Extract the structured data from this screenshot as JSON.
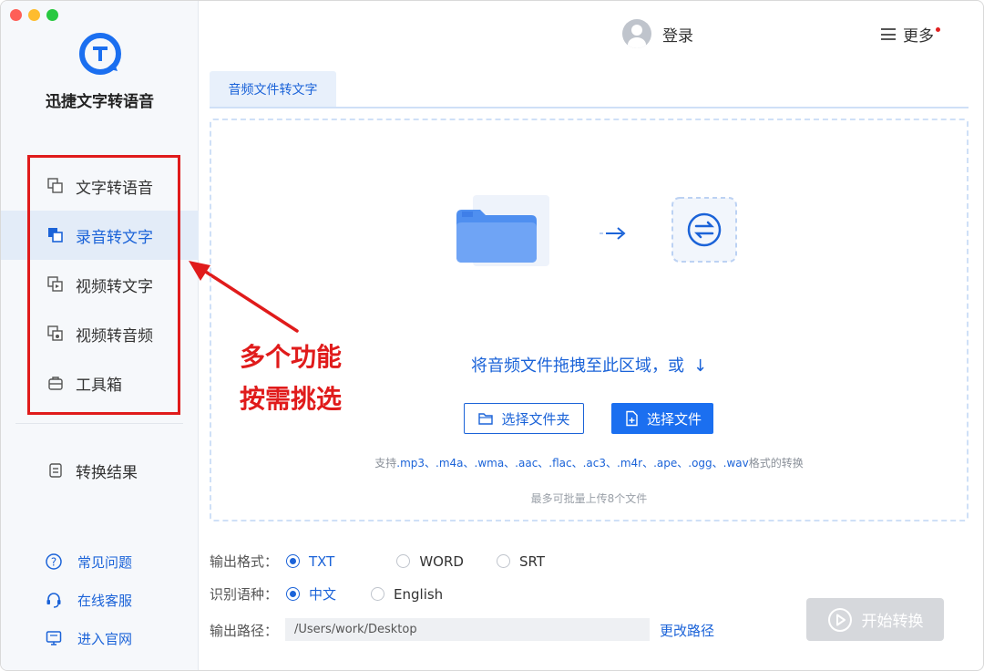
{
  "app": {
    "title": "迅捷文字转语音"
  },
  "colors": {
    "accent": "#1b63d8",
    "annotation": "#e01b1b",
    "sidebar_bg": "#f6f8fb"
  },
  "sidebar": {
    "items": [
      {
        "label": "文字转语音",
        "icon": "text-to-speech-icon",
        "active": false
      },
      {
        "label": "录音转文字",
        "icon": "recording-to-text-icon",
        "active": true
      },
      {
        "label": "视频转文字",
        "icon": "video-to-text-icon",
        "active": false
      },
      {
        "label": "视频转音频",
        "icon": "video-to-audio-icon",
        "active": false
      },
      {
        "label": "工具箱",
        "icon": "toolbox-icon",
        "active": false
      }
    ],
    "result": {
      "label": "转换结果",
      "icon": "result-icon"
    },
    "links": [
      {
        "label": "常见问题",
        "icon": "question-icon"
      },
      {
        "label": "在线客服",
        "icon": "headset-icon"
      },
      {
        "label": "进入官网",
        "icon": "monitor-icon"
      }
    ]
  },
  "annotation": {
    "line1": "多个功能",
    "line2": "按需挑选"
  },
  "header": {
    "login_label": "登录",
    "more_label": "更多"
  },
  "tab": {
    "label": "音频文件转文字"
  },
  "dropzone": {
    "hint": "将音频文件拖拽至此区域，或",
    "select_folder": "选择文件夹",
    "select_file": "选择文件",
    "support_prefix": "支持",
    "support_formats": ".mp3、.m4a、.wma、.aac、.flac、.ac3、.m4r、.ape、.ogg、.wav",
    "support_suffix": "格式的转换",
    "limit": "最多可批量上传8个文件"
  },
  "options": {
    "format_label": "输出格式：",
    "formats": [
      {
        "label": "TXT",
        "checked": true
      },
      {
        "label": "WORD",
        "checked": false
      },
      {
        "label": "SRT",
        "checked": false
      }
    ],
    "language_label": "识别语种：",
    "languages": [
      {
        "label": "中文",
        "checked": true
      },
      {
        "label": "English",
        "checked": false
      }
    ],
    "path_label": "输出路径：",
    "path_value": "/Users/work/Desktop",
    "change_path": "更改路径",
    "start_label": "开始转换"
  }
}
